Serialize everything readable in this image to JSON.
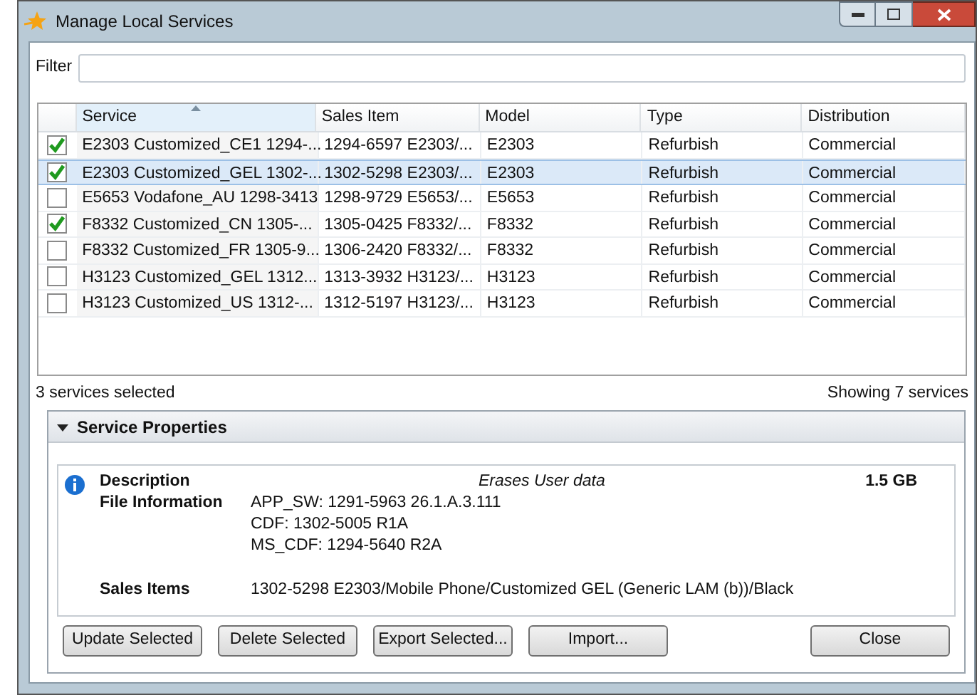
{
  "window": {
    "title": "Manage Local Services"
  },
  "filter": {
    "label": "Filter"
  },
  "table": {
    "columns": [
      {
        "label": "Service",
        "sorted": true
      },
      {
        "label": "Sales Item",
        "sorted": false
      },
      {
        "label": "Model",
        "sorted": false
      },
      {
        "label": "Type",
        "sorted": false
      },
      {
        "label": "Distribution",
        "sorted": false
      }
    ],
    "rows": [
      {
        "checked": true,
        "selected": false,
        "cells": [
          "E2303 Customized_CE1 1294-...",
          "1294-6597 E2303/...",
          "E2303",
          "Refurbish",
          "Commercial"
        ]
      },
      {
        "checked": true,
        "selected": true,
        "cells": [
          "E2303 Customized_GEL 1302-...",
          "1302-5298 E2303/...",
          "E2303",
          "Refurbish",
          "Commercial"
        ]
      },
      {
        "checked": false,
        "selected": false,
        "cells": [
          "E5653 Vodafone_AU 1298-3413",
          "1298-9729 E5653/...",
          "E5653",
          "Refurbish",
          "Commercial"
        ]
      },
      {
        "checked": true,
        "selected": false,
        "cells": [
          "F8332 Customized_CN 1305-...",
          "1305-0425 F8332/...",
          "F8332",
          "Refurbish",
          "Commercial"
        ]
      },
      {
        "checked": false,
        "selected": false,
        "cells": [
          "F8332 Customized_FR 1305-9...",
          "1306-2420 F8332/...",
          "F8332",
          "Refurbish",
          "Commercial"
        ]
      },
      {
        "checked": false,
        "selected": false,
        "cells": [
          "H3123 Customized_GEL 1312...",
          "1313-3932 H3123/...",
          "H3123",
          "Refurbish",
          "Commercial"
        ]
      },
      {
        "checked": false,
        "selected": false,
        "cells": [
          "H3123 Customized_US 1312-...",
          "1312-5197 H3123/...",
          "H3123",
          "Refurbish",
          "Commercial"
        ]
      }
    ]
  },
  "status": {
    "selected": "3 services selected",
    "showing": "Showing 7 services"
  },
  "properties": {
    "title": "Service Properties",
    "expanded": true,
    "description_label": "Description",
    "description": "Erases User data",
    "size": "1.5 GB",
    "file_info_label": "File Information",
    "file_info": [
      "APP_SW: 1291-5963 26.1.A.3.111",
      "CDF: 1302-5005 R1A",
      "MS_CDF: 1294-5640 R2A"
    ],
    "sales_items_label": "Sales Items",
    "sales_items": "1302-5298 E2303/Mobile Phone/Customized GEL (Generic LAM (b))/Black"
  },
  "buttons": [
    "Update Selected",
    "Delete Selected",
    "Export Selected...",
    "Import..."
  ],
  "close_button": "Close"
}
